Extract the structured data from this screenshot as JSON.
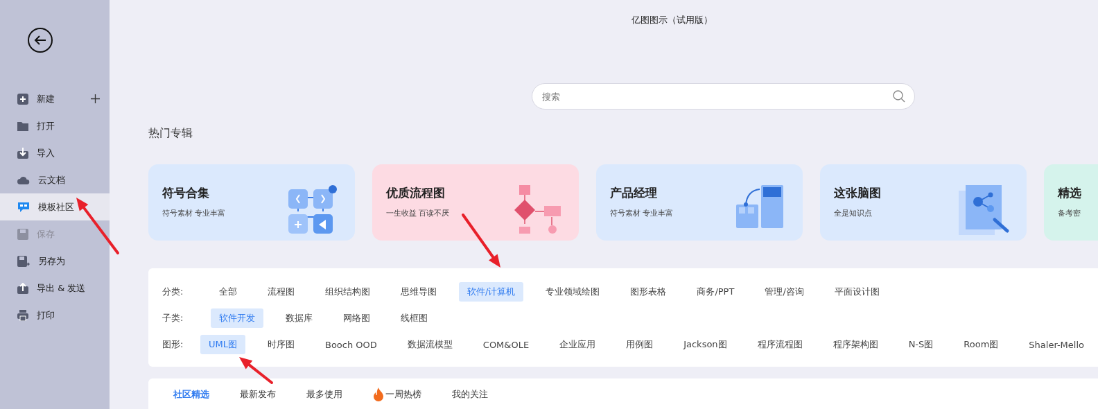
{
  "window": {
    "title": "亿图图示（试用版）"
  },
  "sidebar": {
    "items": [
      {
        "label": "新建",
        "kind": "new",
        "selected": false,
        "disabled": false,
        "add": true
      },
      {
        "label": "打开",
        "kind": "open",
        "selected": false,
        "disabled": false
      },
      {
        "label": "导入",
        "kind": "import",
        "selected": false,
        "disabled": false
      },
      {
        "label": "云文档",
        "kind": "cloud",
        "selected": false,
        "disabled": false
      },
      {
        "label": "模板社区",
        "kind": "community",
        "selected": true,
        "disabled": false
      },
      {
        "label": "保存",
        "kind": "save",
        "selected": false,
        "disabled": true
      },
      {
        "label": "另存为",
        "kind": "saveas",
        "selected": false,
        "disabled": false
      },
      {
        "label": "导出 & 发送",
        "kind": "export",
        "selected": false,
        "disabled": false
      },
      {
        "label": "打印",
        "kind": "print",
        "selected": false,
        "disabled": false
      }
    ]
  },
  "search": {
    "placeholder": "搜索"
  },
  "hot_albums": {
    "title": "热门专辑",
    "cards": [
      {
        "title": "符号合集",
        "subtitle": "符号素材 专业丰富",
        "kind": "symbols",
        "color": "#dbe9fd"
      },
      {
        "title": "优质流程图",
        "subtitle": "一生收益 百读不厌",
        "kind": "flowchart",
        "color": "#fddbe3"
      },
      {
        "title": "产品经理",
        "subtitle": "符号素材 专业丰富",
        "kind": "product",
        "color": "#dbe9fd"
      },
      {
        "title": "这张脑图",
        "subtitle": "全是知识点",
        "kind": "mindmap",
        "color": "#dbe9fd"
      },
      {
        "title": "精选",
        "subtitle": "备考密",
        "kind": "none",
        "color": "#d5f3ec"
      }
    ]
  },
  "filters": [
    {
      "label": "分类:",
      "options": [
        {
          "label": "全部",
          "selected": false
        },
        {
          "label": "流程图",
          "selected": false
        },
        {
          "label": "组织结构图",
          "selected": false
        },
        {
          "label": "思维导图",
          "selected": false
        },
        {
          "label": "软件/计算机",
          "selected": true
        },
        {
          "label": "专业领域绘图",
          "selected": false
        },
        {
          "label": "图形表格",
          "selected": false
        },
        {
          "label": "商务/PPT",
          "selected": false
        },
        {
          "label": "管理/咨询",
          "selected": false
        },
        {
          "label": "平面设计图",
          "selected": false
        }
      ]
    },
    {
      "label": "子类:",
      "options": [
        {
          "label": "软件开发",
          "selected": true
        },
        {
          "label": "数据库",
          "selected": false
        },
        {
          "label": "网络图",
          "selected": false
        },
        {
          "label": "线框图",
          "selected": false
        }
      ]
    },
    {
      "label": "图形:",
      "options": [
        {
          "label": "UML图",
          "selected": true
        },
        {
          "label": "时序图",
          "selected": false
        },
        {
          "label": "Booch OOD",
          "selected": false
        },
        {
          "label": "数据流模型",
          "selected": false
        },
        {
          "label": "COM&OLE",
          "selected": false
        },
        {
          "label": "企业应用",
          "selected": false
        },
        {
          "label": "用例图",
          "selected": false
        },
        {
          "label": "Jackson图",
          "selected": false
        },
        {
          "label": "程序流程图",
          "selected": false
        },
        {
          "label": "程序架构图",
          "selected": false
        },
        {
          "label": "N-S图",
          "selected": false
        },
        {
          "label": "Room图",
          "selected": false
        },
        {
          "label": "Shaler-Mello",
          "selected": false
        }
      ]
    }
  ],
  "feed_tabs": [
    {
      "label": "社区精选",
      "selected": true,
      "hot": false
    },
    {
      "label": "最新发布",
      "selected": false,
      "hot": false
    },
    {
      "label": "最多使用",
      "selected": false,
      "hot": false
    },
    {
      "label": "一周热榜",
      "selected": false,
      "hot": true
    },
    {
      "label": "我的关注",
      "selected": false,
      "hot": false
    }
  ]
}
